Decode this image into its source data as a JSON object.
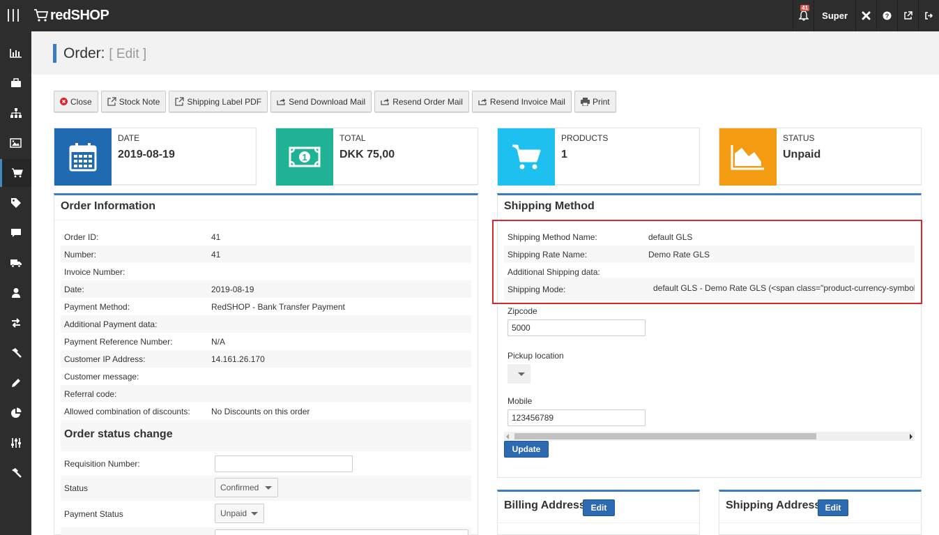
{
  "app": {
    "logo_text": "redSHOP",
    "notification_count": "41",
    "user_label": "Super"
  },
  "colors": {
    "accent": "#3c7dbf",
    "date_box": "#1f6ab0",
    "total_box": "#1fb294",
    "products_box": "#1dc0ef",
    "status_box": "#f39c12",
    "highlight": "#d9272e"
  },
  "page": {
    "title": "Order:",
    "subtitle": "[ Edit ]"
  },
  "toolbar": {
    "close": "Close",
    "stock_note": "Stock Note",
    "shipping_label_pdf": "Shipping Label PDF",
    "send_download_mail": "Send Download Mail",
    "resend_order_mail": "Resend Order Mail",
    "resend_invoice_mail": "Resend Invoice Mail",
    "print": "Print"
  },
  "stats": {
    "date": {
      "label": "DATE",
      "value": "2019-08-19",
      "icon": "calendar-icon"
    },
    "total": {
      "label": "TOTAL",
      "value": "DKK 75,00",
      "icon": "money-icon"
    },
    "products": {
      "label": "PRODUCTS",
      "value": "1",
      "icon": "cart-icon"
    },
    "status": {
      "label": "STATUS",
      "value": "Unpaid",
      "icon": "area-chart-icon"
    }
  },
  "order_info": {
    "title": "Order Information",
    "rows": [
      {
        "k": "Order ID:",
        "v": "41"
      },
      {
        "k": "Number:",
        "v": "41"
      },
      {
        "k": "Invoice Number:",
        "v": ""
      },
      {
        "k": "Date:",
        "v": "2019-08-19"
      },
      {
        "k": "Payment Method:",
        "v": "RedSHOP - Bank Transfer Payment"
      },
      {
        "k": "Additional Payment data:",
        "v": ""
      },
      {
        "k": "Payment Reference Number:",
        "v": "N/A"
      },
      {
        "k": "Customer IP Address:",
        "v": "14.161.26.170"
      },
      {
        "k": "Customer message:",
        "v": ""
      },
      {
        "k": "Referral code:",
        "v": ""
      },
      {
        "k": "Allowed combination of discounts:",
        "v": "No Discounts on this order"
      }
    ],
    "status_change_title": "Order status change",
    "requisition_label": "Requisition Number:",
    "requisition_value": "",
    "status_label": "Status",
    "status_value": "Confirmed",
    "payment_status_label": "Payment Status",
    "payment_status_value": "Unpaid"
  },
  "shipping_method": {
    "title": "Shipping Method",
    "rows": [
      {
        "k": "Shipping Method Name:",
        "v": "default GLS"
      },
      {
        "k": "Shipping Rate Name:",
        "v": "Demo Rate GLS"
      },
      {
        "k": "Additional Shipping data:",
        "v": ""
      },
      {
        "k": "Shipping Mode:",
        "v": "default GLS - Demo Rate GLS (<span class=\"product-currency-symbol"
      }
    ],
    "zipcode_label": "Zipcode",
    "zipcode_value": "5000",
    "pickup_label": "Pickup location",
    "mobile_label": "Mobile",
    "mobile_value": "123456789",
    "update_label": "Update"
  },
  "billing": {
    "title": "Billing Address",
    "edit": "Edit"
  },
  "shipping_address": {
    "title": "Shipping Address",
    "edit": "Edit"
  }
}
